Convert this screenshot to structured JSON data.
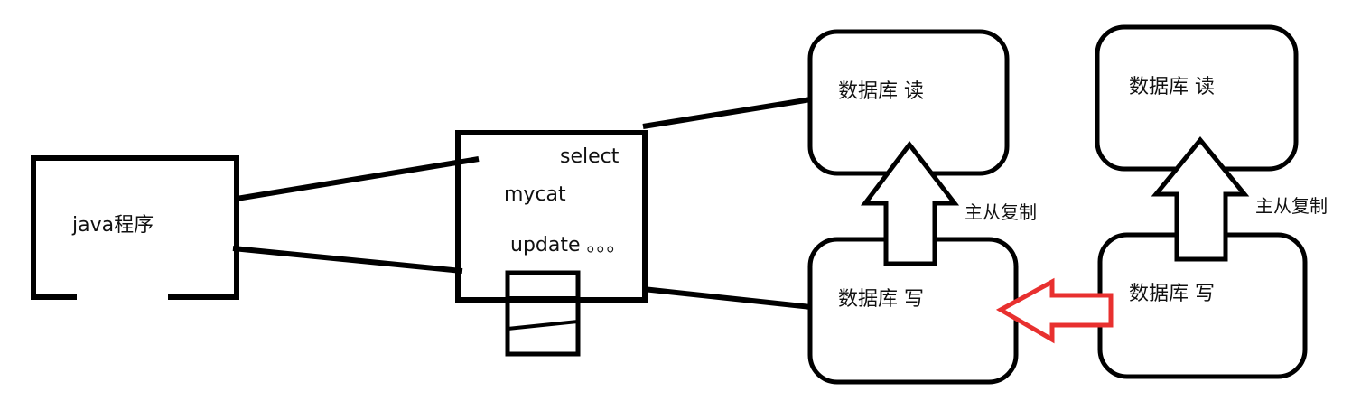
{
  "labels": {
    "java_program": "java程序",
    "mycat": "mycat",
    "select": "select",
    "update": "update 。。。",
    "db_read_1": "数据库   读",
    "db_write_1": "数据库   写",
    "db_read_2": "数据库   读",
    "db_write_2": "数据库   写",
    "replication_1": "主从复制",
    "replication_2": "主从复制"
  },
  "colors": {
    "stroke": "#000000",
    "highlight_arrow": "#e8302f",
    "background": "#ffffff"
  }
}
